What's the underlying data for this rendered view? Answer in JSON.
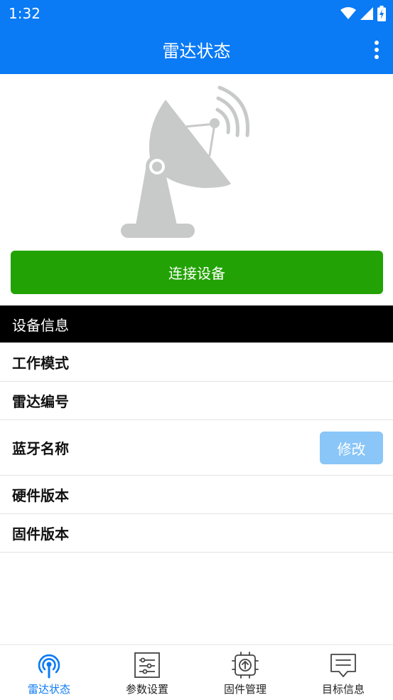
{
  "status_bar": {
    "time": "1:32"
  },
  "app_bar": {
    "title": "雷达状态"
  },
  "connect_button": {
    "label": "连接设备"
  },
  "device_info": {
    "header": "设备信息",
    "rows": [
      {
        "label": "工作模式"
      },
      {
        "label": "雷达编号"
      },
      {
        "label": "蓝牙名称",
        "action_label": "修改"
      },
      {
        "label": "硬件版本"
      },
      {
        "label": "固件版本"
      }
    ]
  },
  "bottom_nav": {
    "items": [
      {
        "label": "雷达状态",
        "icon": "radar-signal-icon",
        "active": true
      },
      {
        "label": "参数设置",
        "icon": "sliders-icon",
        "active": false
      },
      {
        "label": "固件管理",
        "icon": "chip-upload-icon",
        "active": false
      },
      {
        "label": "目标信息",
        "icon": "message-icon",
        "active": false
      }
    ]
  },
  "colors": {
    "primary": "#0a7af5",
    "connect": "#22a204",
    "edit_button": "#8ac6f7",
    "illustration": "#c8c9c9"
  }
}
